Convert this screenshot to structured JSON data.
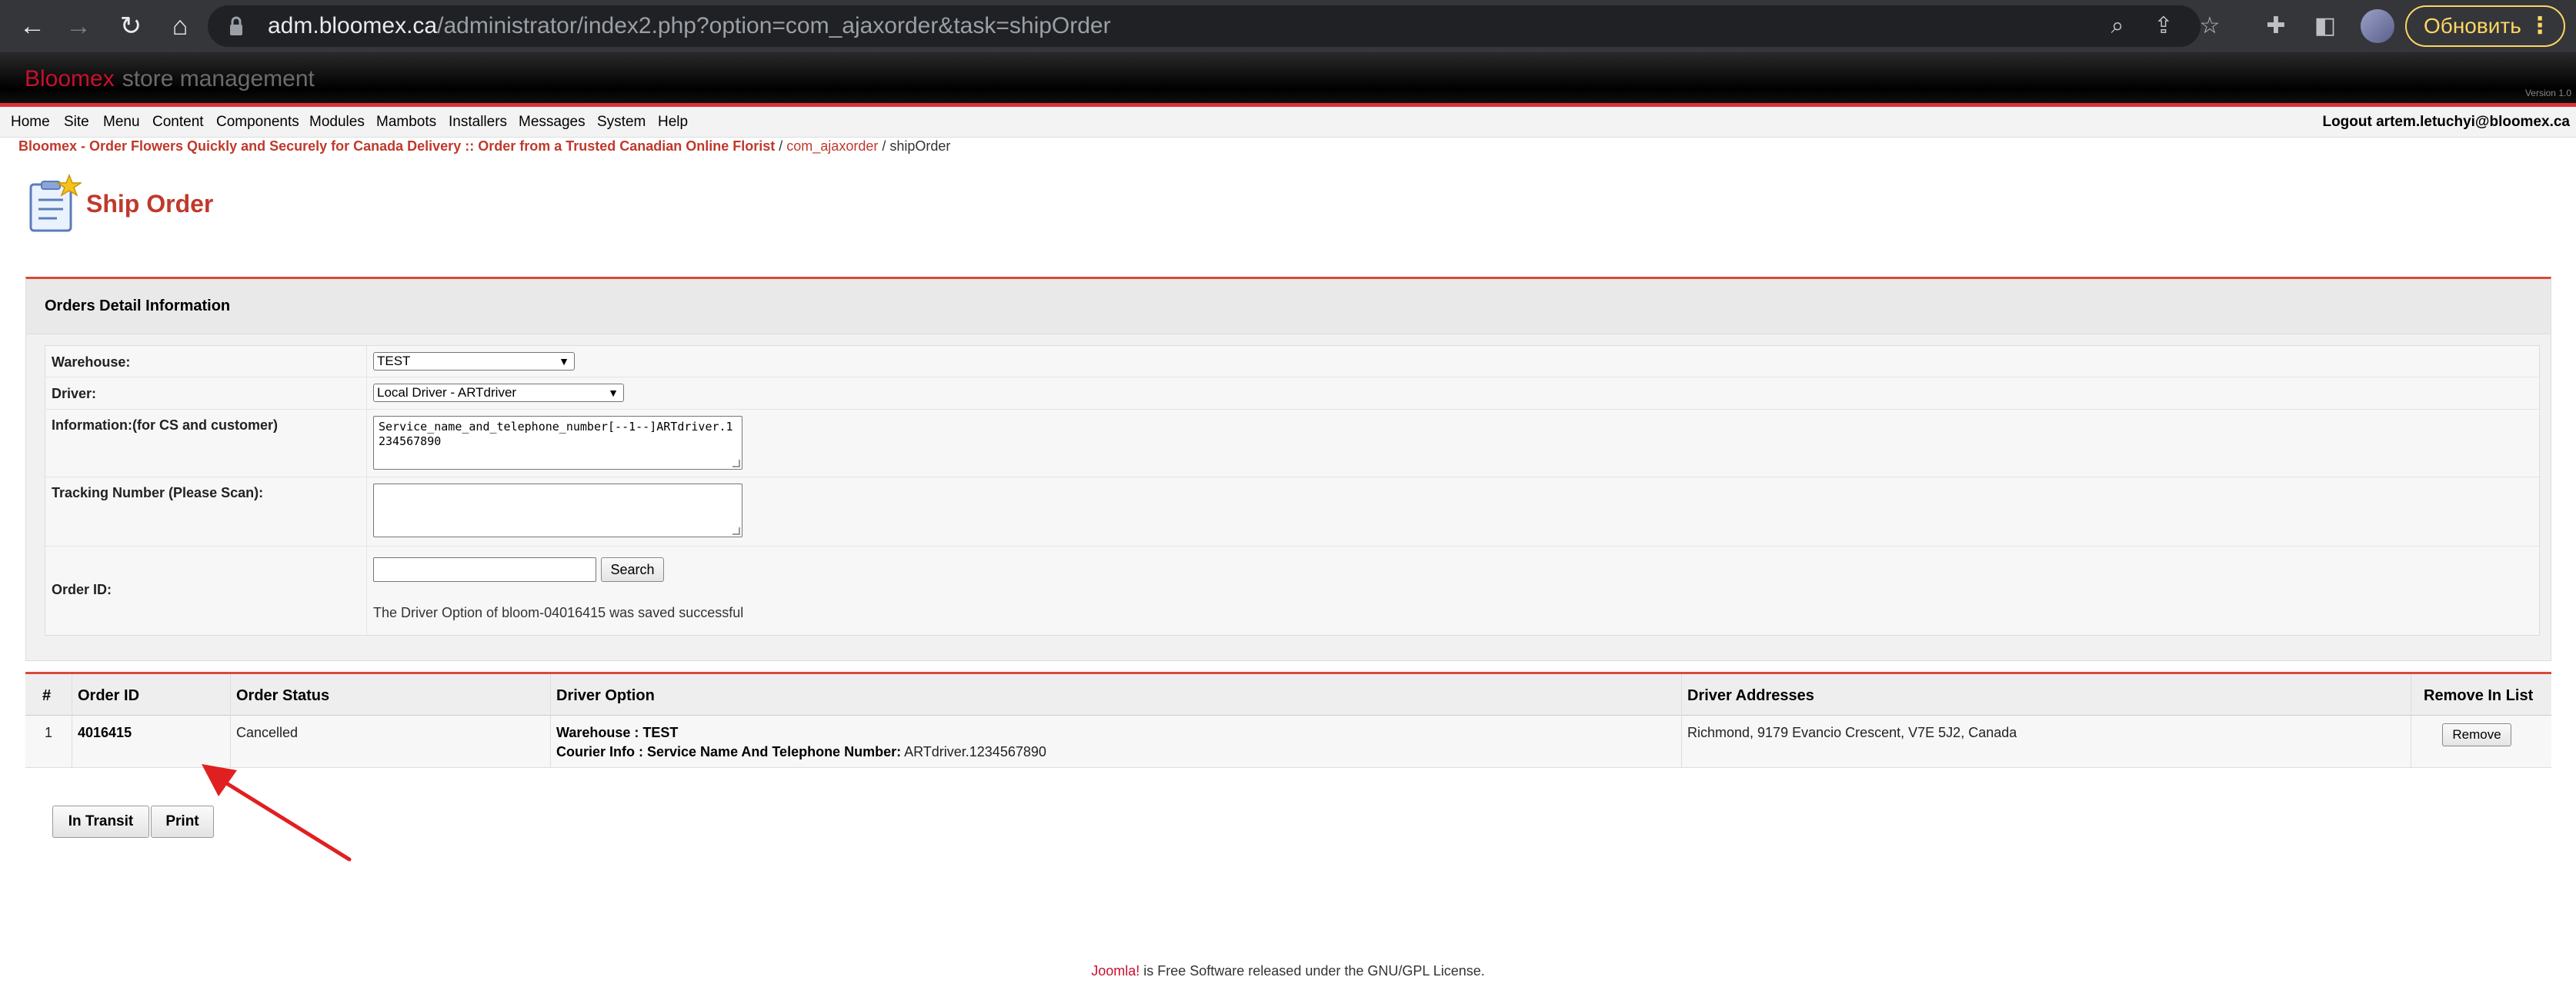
{
  "browser": {
    "url_host": "adm.bloomex.ca",
    "url_path": "/administrator/index2.php?option=com_ajaxorder&task=shipOrder",
    "update_label": "Обновить"
  },
  "header": {
    "brand": "Bloomex",
    "subtitle": "store management",
    "version_label": "Version 1.0"
  },
  "menu": {
    "items": [
      "Home",
      "Site",
      "Menu",
      "Content",
      "Components",
      "Modules",
      "Mambots",
      "Installers",
      "Messages",
      "System",
      "Help"
    ],
    "logout": "Logout artem.letuchyi@bloomex.ca"
  },
  "breadcrumb": {
    "site": "Bloomex - Order Flowers Quickly and Securely for Canada Delivery :: Order from a Trusted Canadian Online Florist",
    "sep1": " / ",
    "component": "com_ajaxorder",
    "sep2": " / ",
    "task": "shipOrder"
  },
  "page": {
    "title": "Ship Order"
  },
  "detail": {
    "panel_title": "Orders Detail Information",
    "warehouse_label": "Warehouse:",
    "warehouse_value": "TEST",
    "driver_label": "Driver:",
    "driver_value": "Local Driver - ARTdriver",
    "info_label": "Information:(for CS and customer)",
    "info_value": "Service_name_and_telephone_number[--1--]ARTdriver.1234567890",
    "tracking_label": "Tracking Number (Please Scan):",
    "tracking_value": "",
    "orderid_label": "Order ID:",
    "orderid_value": "",
    "search_label": "Search",
    "success_message": "The Driver Option of bloom-04016415 was saved successful"
  },
  "orders": {
    "headers": [
      "#",
      "Order ID",
      "Order Status",
      "Driver Option",
      "Driver Addresses",
      "Remove In List"
    ],
    "rows": [
      {
        "num": "1",
        "order_id": "4016415",
        "status": "Cancelled",
        "warehouse_line_label": "Warehouse : TEST",
        "courier_label": "Courier Info : Service Name And Telephone Number:",
        "courier_value": " ARTdriver.1234567890",
        "address": "Richmond, 9179 Evancio Crescent, V7E 5J2, Canada",
        "remove_label": "Remove"
      }
    ]
  },
  "actions": {
    "in_transit": "In Transit",
    "print": "Print"
  },
  "footer": {
    "link": "Joomla!",
    "text": " is Free Software released under the GNU/GPL License."
  },
  "colors": {
    "accent_red": "#c0392b",
    "header_line": "#d74a3a",
    "annotation": "#e02020"
  }
}
